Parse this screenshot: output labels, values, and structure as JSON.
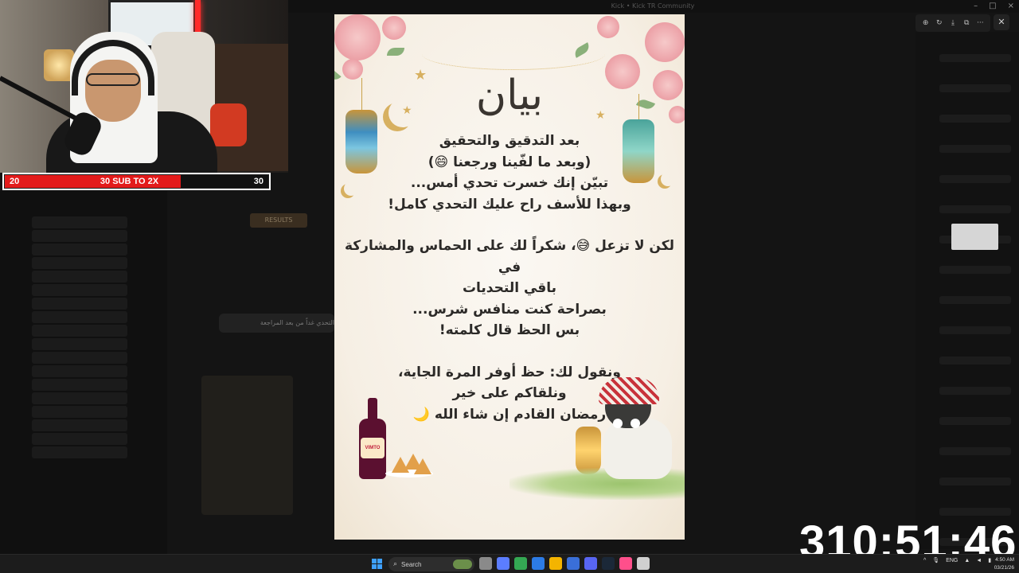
{
  "background_app": {
    "window_title": "Kick • Kick TR Community",
    "bg_chat_snippet": "التحدي غداً من بعد المراجعة",
    "bg_results_label": "RESULTS",
    "window_controls": {
      "minimize": "–",
      "maximize": "□",
      "close": "×"
    }
  },
  "viewer_toolbar": {
    "icons": [
      "zoom-in-icon",
      "rotate-icon",
      "download-icon",
      "open-external-icon",
      "more-icon"
    ],
    "glyphs": {
      "zoom": "⊕",
      "rotate": "↻",
      "download": "⤓",
      "open": "⧉",
      "more": "···",
      "close": "✕"
    }
  },
  "sub_goal": {
    "current": "20",
    "goal_label": "30 SUB TO 2X",
    "target": "30",
    "progress_fraction": 0.667,
    "fill_color": "#e31b1b"
  },
  "poster": {
    "title": "بيان",
    "lines": [
      "بعد التدقيق والتحقيق",
      "(وبعد ما لفّينا ورجعنا 😄)",
      "تبيّن إنك خسرت تحدي أمس...",
      "وبهذا للأسف راح عليك التحدي كامل!",
      "",
      "لكن لا تزعل 😅، شكراً لك على الحماس والمشاركة في",
      "باقي التحديات",
      "بصراحة كنت منافس شرس...",
      "بس الحظ قال كلمته!",
      "",
      "ونقول لك: حظ أوفر المرة الجاية،",
      "ونلقاكم على خير",
      "رمضان القادم إن شاء الله 🌙"
    ],
    "bottle_label": "VIMTO",
    "accent_gold": "#d7b060",
    "flower_pink": "#eea9ae"
  },
  "timer": {
    "value": "310:51:46"
  },
  "taskbar": {
    "search_placeholder": "Search",
    "app_colors": [
      "#8a8a8a",
      "#5b7dff",
      "#34a853",
      "#2c7be5",
      "#f4b400",
      "#3a6fd8",
      "#5865f2",
      "#1b2838",
      "#ff4f8b",
      "#d0d0d0"
    ],
    "tray": {
      "chevron": "^",
      "mic": "🎙",
      "language": "ENG",
      "wifi": "▲",
      "volume": "◄",
      "battery": "▮"
    },
    "clock_time": "4:50 AM",
    "clock_date": "03/21/26"
  }
}
